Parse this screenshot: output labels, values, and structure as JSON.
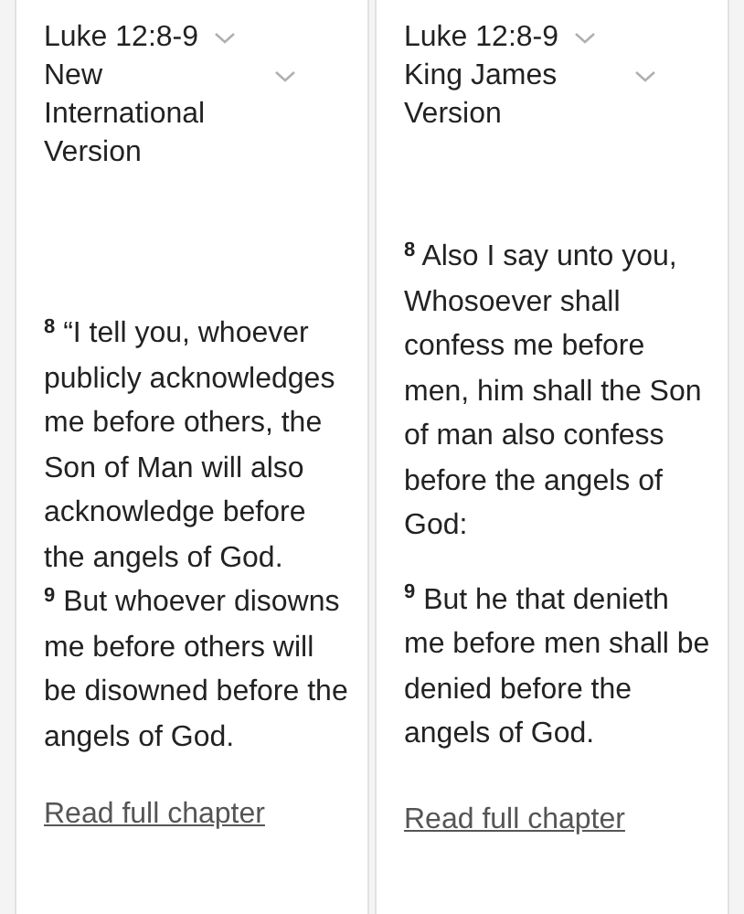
{
  "columns": [
    {
      "reference": "Luke 12:8-9",
      "version": "New International Version",
      "verses": [
        "$^{8}$ “I tell you, whoever publicly acknowledges me before others, the Son of Man will also acknowledge before the angels of God.",
        "$^{9}$ But whoever disowns me before others will be disowned before the angels of God."
      ],
      "link": "Read full chapter"
    },
    {
      "reference": "Luke 12:8-9",
      "version": "King James Version",
      "verses": [
        "$^{8}$ Also I say unto you, Whosoever shall confess me before men, him shall the Son of man also confess before the angels of God:",
        "$^{9}$ But he that denieth me before men shall be denied before the angels of God."
      ],
      "link": "Read full chapter"
    }
  ]
}
